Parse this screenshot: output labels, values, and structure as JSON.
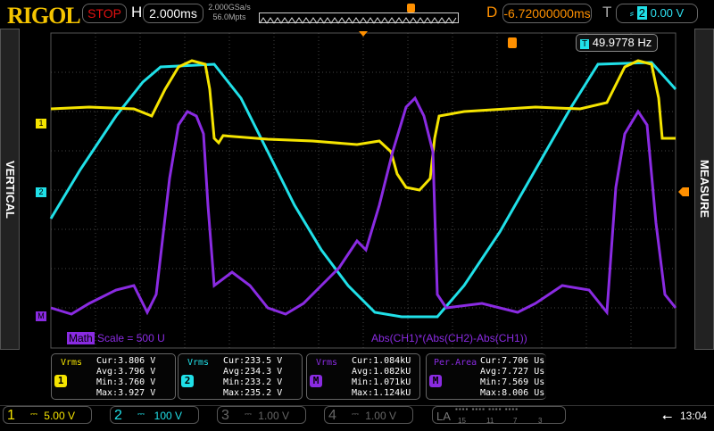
{
  "header": {
    "logo": "RIGOL",
    "run_state": "STOP",
    "h_label": "H",
    "timebase": "2.000ms",
    "sample_rate": "2.000GSa/s",
    "memory_depth": "56.0Mpts",
    "d_label": "D",
    "delay": "-6.72000000ms",
    "t_label": "T",
    "trigger_source": "2",
    "trigger_level": "0.00 V"
  },
  "side": {
    "left": "VERTICAL",
    "right": "MEASURE"
  },
  "frequency_readout": "49.9778 Hz",
  "markers": {
    "ch1": "1",
    "ch2": "2",
    "math": "M"
  },
  "math": {
    "tag": "Math",
    "scale": "Scale = 500 U",
    "expression": "Abs(CH1)*(Abs(CH2)-Abs(CH1))"
  },
  "measurements": [
    {
      "name": "Vrms",
      "badge": "1",
      "color": "#f5e400",
      "cur": "Cur:3.806 V",
      "avg": "Avg:3.796 V",
      "min": "Min:3.760 V",
      "max": "Max:3.927 V"
    },
    {
      "name": "Vrms",
      "badge": "2",
      "color": "#20e0e8",
      "cur": "Cur:233.5 V",
      "avg": "Avg:234.3 V",
      "min": "Min:233.2 V",
      "max": "Max:235.2 V"
    },
    {
      "name": "Vrms",
      "badge": "M",
      "color": "#8a2be2",
      "cur": "Cur:1.084kU",
      "avg": "Avg:1.082kU",
      "min": "Min:1.071kU",
      "max": "Max:1.124kU"
    },
    {
      "name": "Per.Area",
      "badge": "M",
      "color": "#8a2be2",
      "cur": "Cur:7.706 Us",
      "avg": "Avg:7.727 Us",
      "min": "Min:7.569 Us",
      "max": "Max:8.006 Us"
    }
  ],
  "channels": [
    {
      "n": "1",
      "scale": "5.00 V",
      "color": "#f5e400"
    },
    {
      "n": "2",
      "scale": "100 V",
      "color": "#20e0e8"
    },
    {
      "n": "3",
      "scale": "1.00 V",
      "color": "#555"
    },
    {
      "n": "4",
      "scale": "1.00 V",
      "color": "#555"
    }
  ],
  "la": {
    "label": "LA",
    "ticks": [
      "15",
      "11",
      "7",
      "3"
    ]
  },
  "clock": "13:04"
}
